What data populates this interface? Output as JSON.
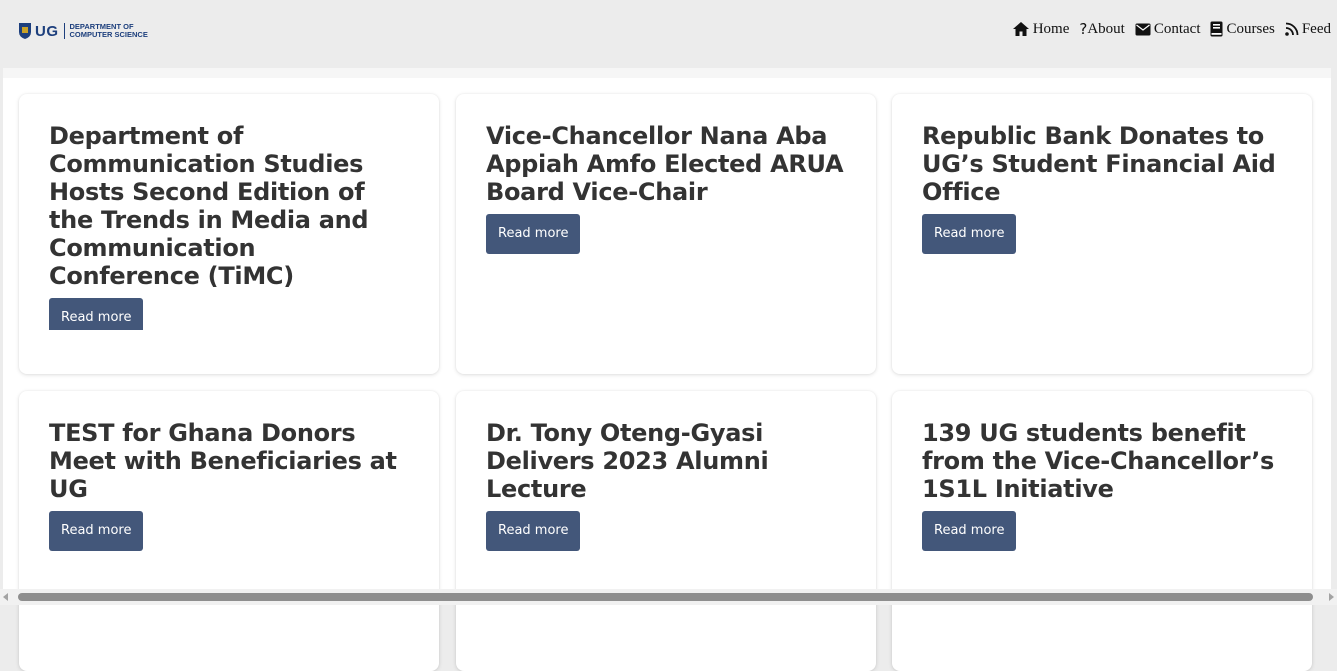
{
  "header": {
    "logo": {
      "short": "UG",
      "dept": "DEPARTMENT OF\nCOMPUTER SCIENCE"
    },
    "nav": [
      {
        "label": "Home",
        "icon": "home-icon"
      },
      {
        "label": "About",
        "icon": "question-icon"
      },
      {
        "label": "Contact",
        "icon": "envelope-icon"
      },
      {
        "label": "Courses",
        "icon": "book-icon"
      },
      {
        "label": "Feed",
        "icon": "rss-icon"
      }
    ]
  },
  "cards": [
    {
      "title": "Department of Communication Studies Hosts Second Edition of the Trends in Media and Communication Conference (TiMC)",
      "button": "Read more"
    },
    {
      "title": "Vice-Chancellor Nana Aba Appiah Amfo Elected ARUA Board Vice-Chair",
      "button": "Read more"
    },
    {
      "title": "Republic Bank Donates to UG’s Student Financial Aid Office",
      "button": "Read more"
    },
    {
      "title": "TEST for Ghana Donors Meet with Beneficiaries at UG",
      "button": "Read more"
    },
    {
      "title": "Dr. Tony Oteng-Gyasi Delivers 2023 Alumni Lecture",
      "button": "Read more"
    },
    {
      "title": "139 UG students benefit from the Vice-Chancellor’s 1S1L Initiative",
      "button": "Read more"
    }
  ],
  "colors": {
    "button_bg": "#43577a",
    "brand": "#1d3f7d"
  }
}
